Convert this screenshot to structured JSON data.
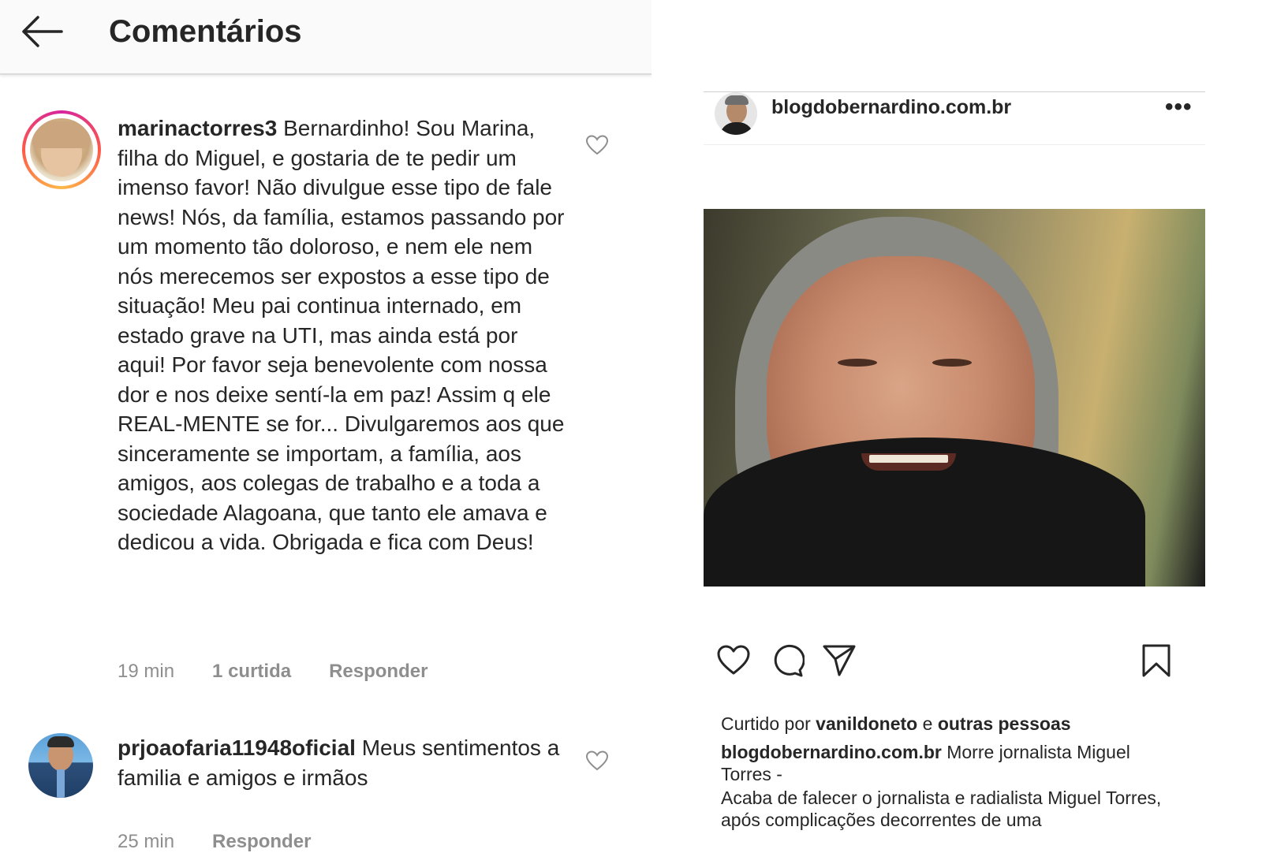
{
  "header": {
    "title": "Comentários",
    "back_icon": "arrow-left-icon"
  },
  "comments": [
    {
      "username": "marinactorres3",
      "text": "Bernardinho! Sou Marina, filha do Miguel, e gostaria de te pedir um imenso favor! Não divulgue esse tipo de fale news! Nós, da família, estamos passando por um momento tão doloroso, e nem ele nem nós merecemos ser expostos a esse tipo de situação! Meu pai continua internado, em estado grave na UTI, mas ainda está por aqui! Por favor seja benevolente com nossa dor e nos deixe sentí-la em paz! Assim q ele REAL-MENTE se for... Divulgaremos aos que sinceramente se importam, a família, aos amigos, aos colegas de trabalho e a toda a sociedade Alagoana, que tanto ele amava e  dedicou a vida. Obrigada e fica com Deus!",
      "time": "19 min",
      "likes": "1 curtida",
      "reply_label": "Responder"
    },
    {
      "username": "prjoaofaria11948oficial",
      "text": "Meus sentimentos a familia e amigos e irmãos",
      "time": "25 min",
      "reply_label": "Responder"
    }
  ],
  "post": {
    "username": "blogdobernardino.com.br",
    "more_label": "•••",
    "likes_prefix": "Curtido por",
    "liked_by": "vanildoneto",
    "likes_connector": "e",
    "likes_others": "outras pessoas",
    "caption_title": "Morre jornalista Miguel Torres -",
    "caption_text": "Acaba de falecer o jornalista e radialista Miguel Torres, após complicações decorrentes de uma"
  },
  "colors": {
    "text": "#262626",
    "secondary": "#8e8e8e",
    "header_bg": "#fafafa",
    "story_ring": [
      "#d6249f",
      "#fd5949",
      "#fdb94a"
    ]
  },
  "icons": [
    "arrow-left-icon",
    "heart-icon",
    "comment-icon",
    "share-icon",
    "bookmark-icon",
    "more-icon"
  ]
}
